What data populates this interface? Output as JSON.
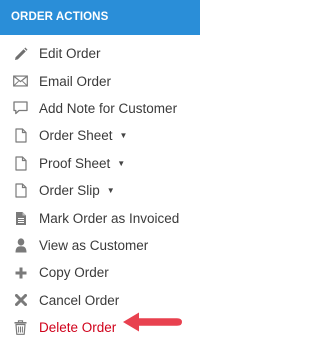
{
  "header": {
    "title": "ORDER ACTIONS"
  },
  "colors": {
    "accent": "#2a8ed8",
    "danger": "#d0021b",
    "arrow": "#e8414f",
    "icon": "#8a8a8a"
  },
  "menu": {
    "items": [
      {
        "label": "Edit Order",
        "icon": "pencil-icon"
      },
      {
        "label": "Email Order",
        "icon": "envelope-icon"
      },
      {
        "label": "Add Note for Customer",
        "icon": "comment-icon"
      },
      {
        "label": "Order Sheet",
        "icon": "document-icon",
        "dropdown": true
      },
      {
        "label": "Proof Sheet",
        "icon": "document-icon",
        "dropdown": true
      },
      {
        "label": "Order Slip",
        "icon": "document-icon",
        "dropdown": true
      },
      {
        "label": "Mark Order as Invoiced",
        "icon": "invoice-icon"
      },
      {
        "label": "View as Customer",
        "icon": "user-icon"
      },
      {
        "label": "Copy Order",
        "icon": "plus-icon"
      },
      {
        "label": "Cancel Order",
        "icon": "x-icon"
      },
      {
        "label": "Delete Order",
        "icon": "trash-icon"
      }
    ]
  },
  "caret_glyph": "▼"
}
